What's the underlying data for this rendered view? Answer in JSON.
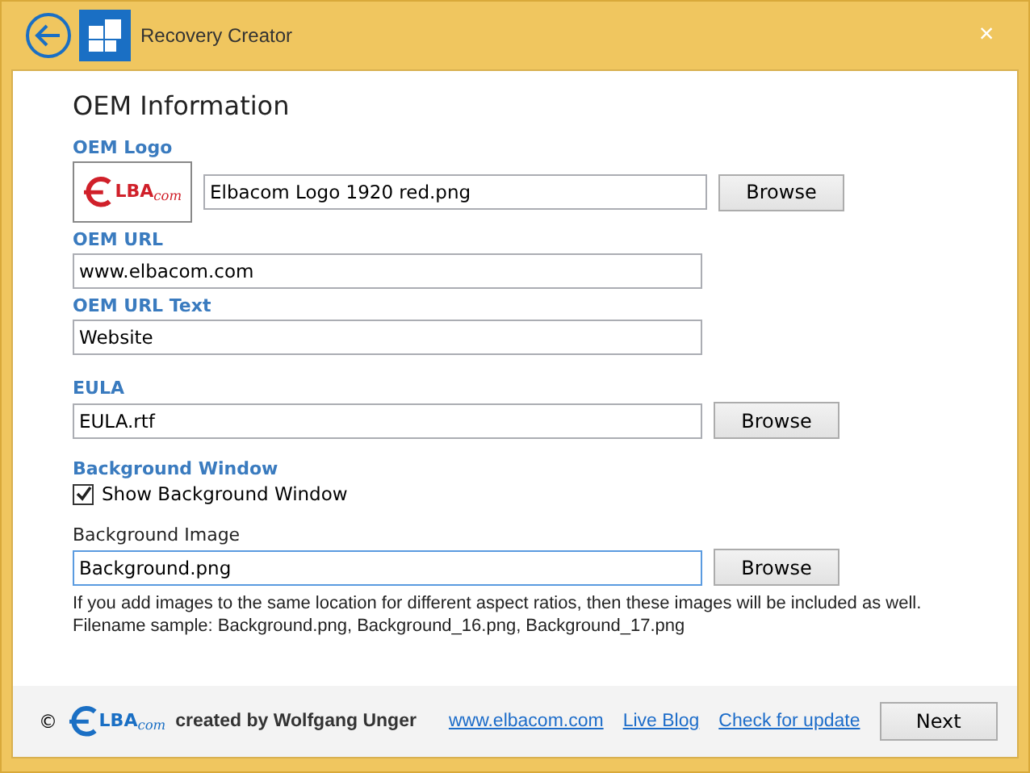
{
  "window": {
    "title": "Recovery Creator",
    "close": "×"
  },
  "heading": "OEM Information",
  "fields": [
    {
      "kind": "logo",
      "label": "OEM Logo",
      "value": "Elbacom Logo 1920 red.png",
      "button": "Browse",
      "logo_text": "LBA",
      "logo_suffix": "com"
    },
    {
      "kind": "text",
      "label": "OEM URL",
      "value": "www.elbacom.com"
    },
    {
      "kind": "text",
      "label": "OEM URL Text",
      "value": "Website"
    },
    {
      "kind": "file",
      "label": "EULA",
      "value": "EULA.rtf",
      "button": "Browse"
    }
  ],
  "background": {
    "label": "Background Window",
    "checkbox": {
      "label": "Show Background Window",
      "checked": true
    },
    "image_label": "Background Image",
    "value": "Background.png",
    "focused": true,
    "button": "Browse",
    "notes": [
      "If you add images to the same location for different aspect ratios, then these images will be included as well.",
      "Filename sample: Background.png, Background_16.png, Background_17.png"
    ]
  },
  "footer": {
    "copyright": "©",
    "logo_text": "LBA",
    "logo_suffix": "com",
    "credit": "created by Wolfgang Unger",
    "links": [
      "www.elbacom.com",
      "Live Blog",
      "Check for update"
    ],
    "next": "Next"
  }
}
